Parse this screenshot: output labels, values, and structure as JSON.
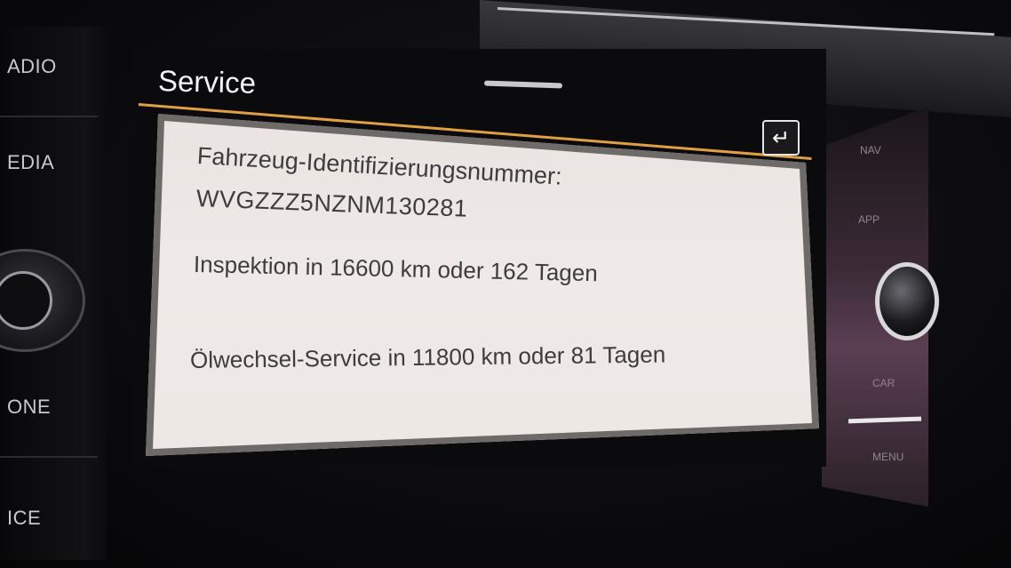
{
  "hardware": {
    "left_buttons": [
      "ADIO",
      "EDIA",
      "ONE",
      "ICE"
    ],
    "right_buttons": [
      "NAV",
      "APP",
      "CAR",
      "MENU"
    ]
  },
  "screen": {
    "title": "Service",
    "back_icon": "return-arrow-icon",
    "back_glyph": "↵"
  },
  "service_info": {
    "vin_label": "Fahrzeug-Identifizierungsnummer:",
    "vin_value": "WVGZZZ5NZNM130281",
    "inspection_text": "Inspektion in 16600 km oder 162 Tagen",
    "oil_change_text": "Ölwechsel-Service in 11800 km oder 81 Tagen"
  },
  "colors": {
    "accent": "#e0a040",
    "panel_bg": "#ece6e3",
    "text": "#3e3c3c"
  }
}
